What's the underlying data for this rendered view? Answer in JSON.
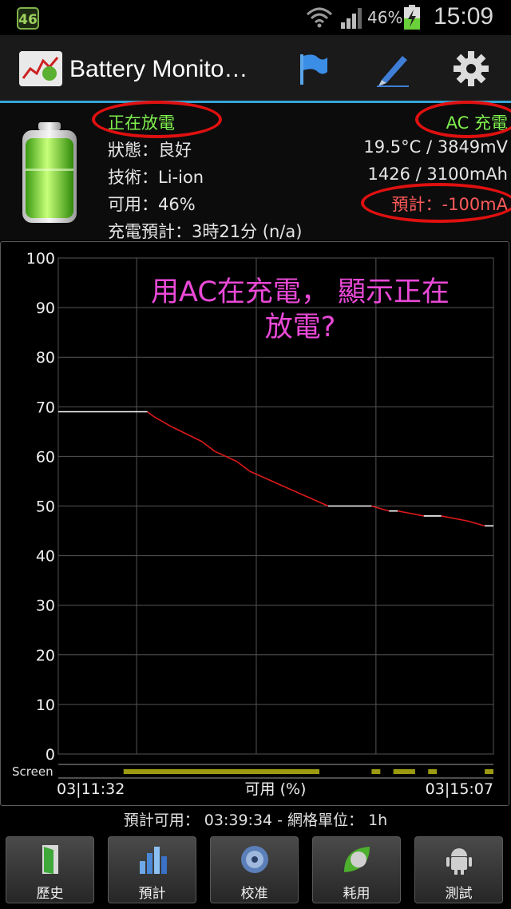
{
  "status_bar": {
    "network_badge": "46",
    "battery_percent": "46%",
    "time": "15:09"
  },
  "action_bar": {
    "title": "Battery Monito…",
    "icons": [
      "app-icon",
      "flag-icon",
      "pencil-icon",
      "gear-icon"
    ],
    "accent_color": "#35a6d6"
  },
  "info": {
    "state_label": "正在放電",
    "status": "狀態：良好",
    "technology": "技術：Li-ion",
    "available": "可用：46%",
    "charge_estimate": "充電預計：3時21分 (n/a)",
    "power_source": "AC 充電",
    "temp_voltage": "19.5°C / 3849mV",
    "capacity": "1426 / 3100mAh",
    "current_estimate": "預計：-100mA"
  },
  "annotation": {
    "line1": "用AC在充電， 顯示正在",
    "line2": "放電?"
  },
  "chart_data": {
    "type": "line",
    "ylim": [
      0,
      100
    ],
    "y_ticks": [
      "0",
      "10",
      "20",
      "30",
      "40",
      "50",
      "60",
      "70",
      "80",
      "90",
      "100"
    ],
    "x_start_label": "03|11:32",
    "x_end_label": "03|15:07",
    "xlabel": "可用 (%)",
    "screen_label": "Screen",
    "series": [
      {
        "x": [
          0,
          0.205,
          0.22,
          0.26,
          0.33,
          0.36,
          0.41,
          0.44,
          0.62,
          0.72,
          0.76,
          0.78,
          0.84,
          0.88,
          0.94,
          0.98,
          1.0
        ],
        "values": [
          69,
          69,
          68,
          66,
          63,
          61,
          59,
          57,
          50,
          50,
          49,
          49,
          48,
          48,
          47,
          46,
          46
        ],
        "discharging_color": "#dd1a1a",
        "flat_color": "#ffffff"
      }
    ],
    "screen_on_segments": [
      [
        0.15,
        0.6
      ],
      [
        0.72,
        0.74
      ],
      [
        0.77,
        0.82
      ],
      [
        0.85,
        0.87
      ],
      [
        0.98,
        1.0
      ]
    ],
    "grid": true,
    "grid_color": "#555555"
  },
  "footer_info": "預計可用： 03:39:34 - 網格單位： 1h",
  "bottom_buttons": [
    {
      "label": "歷史",
      "icon": "door-icon"
    },
    {
      "label": "預計",
      "icon": "bar-chart-icon"
    },
    {
      "label": "校准",
      "icon": "disc-icon"
    },
    {
      "label": "耗用",
      "icon": "leaf-icon"
    },
    {
      "label": "測試",
      "icon": "android-icon"
    }
  ]
}
